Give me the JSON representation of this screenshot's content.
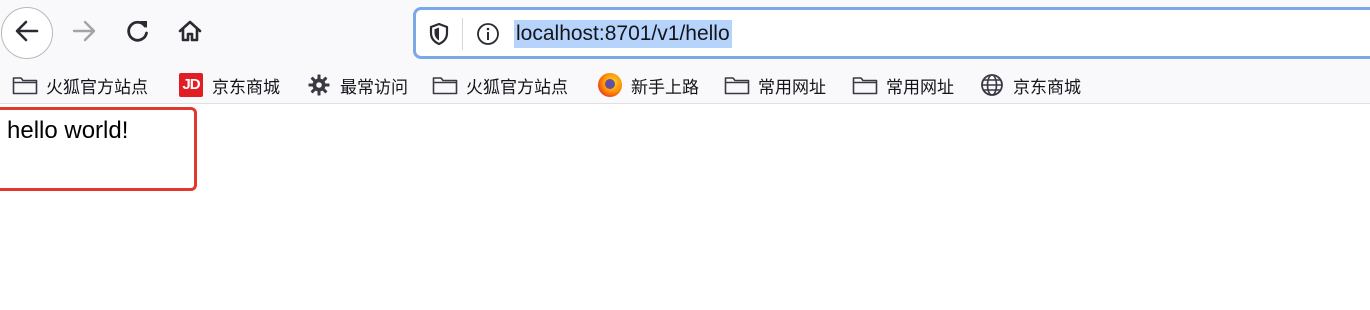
{
  "navigation": {
    "back_icon": "arrow-left-icon",
    "forward_icon": "arrow-right-icon",
    "reload_icon": "reload-icon",
    "home_icon": "home-icon"
  },
  "urlbar": {
    "url": "localhost:8701/v1/hello",
    "shield_icon": "shield-icon",
    "info_icon": "info-icon",
    "highlight_color": "#b5d3fb",
    "focus_color": "#7aa9e6"
  },
  "bookmarks": {
    "items": [
      {
        "label": "火狐官方站点",
        "icon": "folder-icon"
      },
      {
        "label": "京东商城",
        "icon": "jd-icon",
        "badge_text": "JD"
      },
      {
        "label": "最常访问",
        "icon": "gear-icon"
      },
      {
        "label": "火狐官方站点",
        "icon": "folder-icon"
      },
      {
        "label": "新手上路",
        "icon": "firefox-icon"
      },
      {
        "label": "常用网址",
        "icon": "folder-icon"
      },
      {
        "label": "常用网址",
        "icon": "folder-icon"
      },
      {
        "label": "京东商城",
        "icon": "globe-icon"
      }
    ]
  },
  "page": {
    "text": "hello world!",
    "annotation_color": "#e03a2f"
  }
}
